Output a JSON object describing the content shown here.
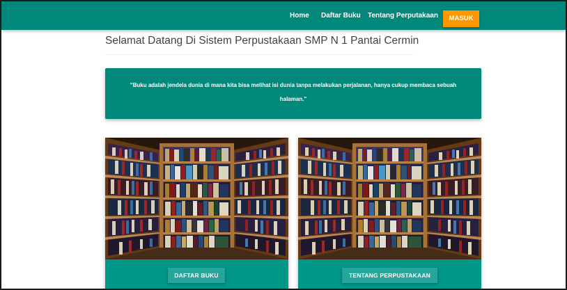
{
  "navbar": {
    "links": [
      {
        "label": "Home"
      },
      {
        "label": "Daftar Buku"
      },
      {
        "label": "Tentang Perputakaan"
      }
    ],
    "login_label": "MASUK",
    "color": "#00897b",
    "login_color": "#ff9800"
  },
  "main": {
    "title": "Selamat Datang Di Sistem Perpustakaan SMP N 1 Pantai Cermin",
    "quote": "\"Buku adalah jendela dunia di mana kita bisa melihat isi dunia tanpa melakukan perjalanan, hanya cukup membaca sebuah halaman.\""
  },
  "cards": [
    {
      "image": "library-bookshelves-image",
      "button_label": "DAFTAR BUKU"
    },
    {
      "image": "library-bookshelves-image",
      "button_label": "TENTANG PERPUSTAKAAN"
    }
  ],
  "colors": {
    "accent": "#009688",
    "button": "#26a69a"
  }
}
